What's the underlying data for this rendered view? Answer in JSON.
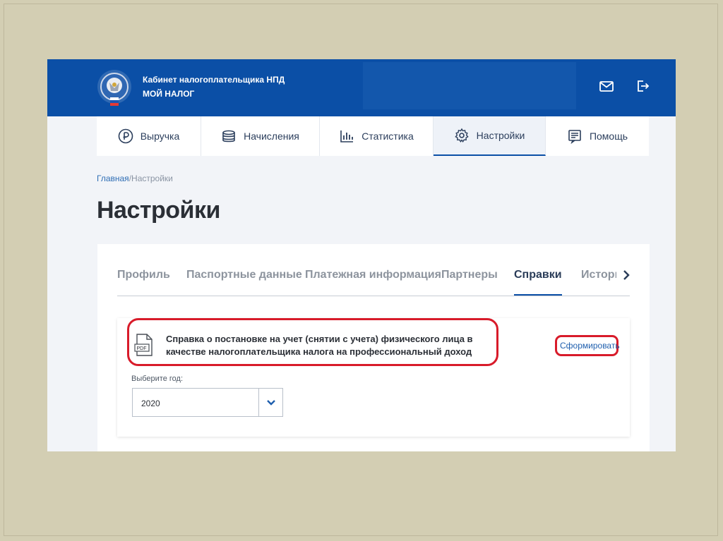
{
  "header": {
    "title_line1": "Кабинет налогоплательщика НПД",
    "title_line2": "МОЙ НАЛОГ",
    "icons": [
      "emblem-logo",
      "mail-icon",
      "logout-icon"
    ]
  },
  "nav": [
    {
      "label": "Выручка",
      "icon": "ruble-icon"
    },
    {
      "label": "Начисления",
      "icon": "coins-icon"
    },
    {
      "label": "Статистика",
      "icon": "bar-chart-icon"
    },
    {
      "label": "Настройки",
      "icon": "gear-icon",
      "active": true
    },
    {
      "label": "Помощь",
      "icon": "help-doc-icon"
    }
  ],
  "breadcrumb": {
    "home": "Главная",
    "separator": "/",
    "current": "Настройки"
  },
  "page_title": "Настройки",
  "tabs": [
    {
      "label": "Профиль"
    },
    {
      "label": "Паспортные данные"
    },
    {
      "label": "Платежная информация"
    },
    {
      "label": "Партнеры"
    },
    {
      "label": "Справки",
      "active": true
    },
    {
      "label": "История"
    }
  ],
  "document": {
    "icon_label": "PDF",
    "title": "Справка о постановке на учет (снятии с учета) физического лица в качестве налогоплательщика налога на профессиональный доход",
    "action_label": "Сформировать"
  },
  "year_select": {
    "label": "Выберите год:",
    "value": "2020"
  },
  "colors": {
    "header_blue": "#0b4fa6",
    "highlight_red": "#d81b2a",
    "link_blue": "#1f5fae"
  }
}
